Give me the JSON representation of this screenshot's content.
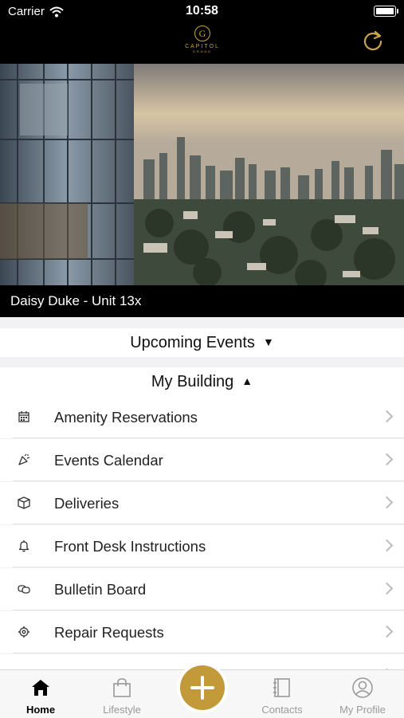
{
  "status_bar": {
    "carrier": "Carrier",
    "time": "10:58"
  },
  "header": {
    "logo_text": "CAPITOL",
    "logo_subtext": "GRAND",
    "logo_monogram": "G",
    "refresh_icon": "refresh-icon",
    "accent_color": "#c9a44a"
  },
  "hero": {
    "caption": "Daisy Duke - Unit 13x"
  },
  "sections": {
    "upcoming_events": {
      "label": "Upcoming Events",
      "state_glyph": "▼"
    },
    "my_building": {
      "label": "My Building",
      "state_glyph": "▲"
    }
  },
  "menu": {
    "items": [
      {
        "label": "Amenity Reservations",
        "icon": "calendar-icon"
      },
      {
        "label": "Events Calendar",
        "icon": "party-popper-icon"
      },
      {
        "label": "Deliveries",
        "icon": "package-icon"
      },
      {
        "label": "Front Desk Instructions",
        "icon": "bell-icon"
      },
      {
        "label": "Bulletin Board",
        "icon": "chat-icon"
      },
      {
        "label": "Repair Requests",
        "icon": "wrench-icon"
      }
    ]
  },
  "tabbar": {
    "tabs": [
      {
        "label": "Home",
        "icon": "home-icon",
        "active": true
      },
      {
        "label": "Lifestyle",
        "icon": "shopping-bag-icon",
        "active": false
      },
      {
        "label": "Contacts",
        "icon": "contacts-book-icon",
        "active": false
      },
      {
        "label": "My Profile",
        "icon": "profile-icon",
        "active": false
      }
    ],
    "fab_icon": "plus-icon",
    "fab_color": "#c39a3a"
  }
}
